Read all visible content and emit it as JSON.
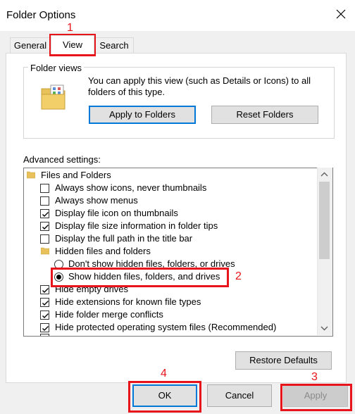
{
  "window": {
    "title": "Folder Options"
  },
  "tabs": [
    {
      "label": "General"
    },
    {
      "label": "View"
    },
    {
      "label": "Search"
    }
  ],
  "folder_views": {
    "legend": "Folder views",
    "description_line1": "You can apply this view (such as Details or Icons) to all",
    "description_line2": "folders of this type.",
    "apply_label": "Apply to Folders",
    "reset_label": "Reset Folders"
  },
  "advanced": {
    "label": "Advanced settings:",
    "items": [
      {
        "type": "folder",
        "label": "Files and Folders"
      },
      {
        "type": "checkbox",
        "label": "Always show icons, never thumbnails",
        "checked": false
      },
      {
        "type": "checkbox",
        "label": "Always show menus",
        "checked": false
      },
      {
        "type": "checkbox",
        "label": "Display file icon on thumbnails",
        "checked": true
      },
      {
        "type": "checkbox",
        "label": "Display file size information in folder tips",
        "checked": true
      },
      {
        "type": "checkbox",
        "label": "Display the full path in the title bar",
        "checked": false
      },
      {
        "type": "folder",
        "label": "Hidden files and folders"
      },
      {
        "type": "radio",
        "label": "Don't show hidden files, folders, or drives",
        "checked": false
      },
      {
        "type": "radio",
        "label": "Show hidden files, folders, and drives",
        "checked": true
      },
      {
        "type": "checkbox",
        "label": "Hide empty drives",
        "checked": true
      },
      {
        "type": "checkbox",
        "label": "Hide extensions for known file types",
        "checked": true
      },
      {
        "type": "checkbox",
        "label": "Hide folder merge conflicts",
        "checked": true
      },
      {
        "type": "checkbox",
        "label": "Hide protected operating system files (Recommended)",
        "checked": true
      }
    ],
    "restore_label": "Restore Defaults"
  },
  "footer": {
    "ok_label": "OK",
    "cancel_label": "Cancel",
    "apply_label": "Apply"
  },
  "annotations": {
    "n1": "1",
    "n2": "2",
    "n3": "3",
    "n4": "4"
  },
  "colors": {
    "annotation_red": "#e8141b",
    "focus_blue": "#0078d7"
  }
}
